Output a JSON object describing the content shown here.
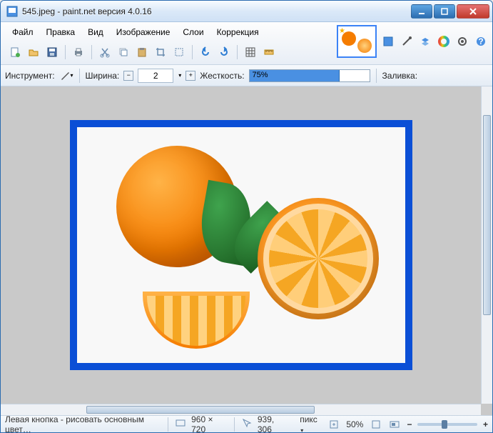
{
  "window": {
    "title": "545.jpeg - paint.net версия 4.0.16"
  },
  "menubar": [
    "Файл",
    "Правка",
    "Вид",
    "Изображение",
    "Слои",
    "Коррекция"
  ],
  "toolbar_icons": [
    "new",
    "open",
    "save",
    "print",
    "cut",
    "copy",
    "paste",
    "crop",
    "deselect",
    "undo",
    "redo",
    "grid",
    "ruler"
  ],
  "aux_icons": [
    "panel",
    "tool",
    "layers",
    "colors",
    "history",
    "settings",
    "help"
  ],
  "toolrow": {
    "instrument_label": "Инструмент:",
    "width_label": "Ширина:",
    "width_value": "2",
    "hardness_label": "Жесткость:",
    "hardness_value": "75%",
    "hardness_percent": 75,
    "fill_label": "Заливка:"
  },
  "status": {
    "hint": "Левая кнопка - рисовать основным цвет…",
    "dims": "960 × 720",
    "cursor": "939, 306",
    "unit": "пикс",
    "zoom": "50%"
  }
}
